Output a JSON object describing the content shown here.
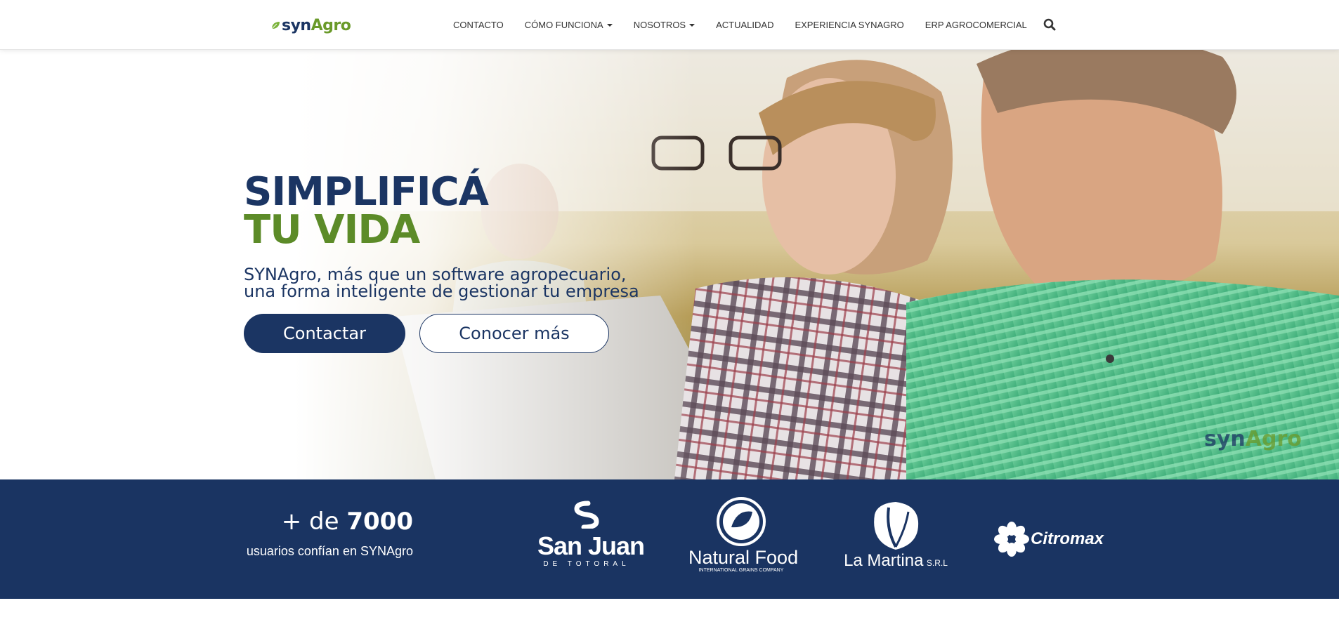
{
  "brand": {
    "logo_syn": "syn",
    "logo_agro": "Agro",
    "colors": {
      "navy": "#1b3563",
      "green": "#5c8b28"
    }
  },
  "nav": {
    "items": [
      {
        "label": "CONTACTO",
        "dropdown": false
      },
      {
        "label": "CÓMO FUNCIONA",
        "dropdown": true
      },
      {
        "label": "NOSOTROS",
        "dropdown": true
      },
      {
        "label": "ACTUALIDAD",
        "dropdown": false
      },
      {
        "label": "EXPERIENCIA SYNAGRO",
        "dropdown": false
      },
      {
        "label": "ERP AGROCOMERCIAL",
        "dropdown": false
      }
    ],
    "search_icon": "search-icon"
  },
  "hero": {
    "headline_line1": "SIMPLIFICÁ",
    "headline_line2": "TU VIDA",
    "subtitle_line1": "SYNAgro, más que un software agropecuario,",
    "subtitle_line2": "una forma inteligente de gestionar tu empresa",
    "primary_button": "Contactar",
    "secondary_button": "Conocer más",
    "watermark_syn": "syn",
    "watermark_agro": "Agro"
  },
  "clients": {
    "count_prefix": "+ de ",
    "count_value": "7000",
    "count_text": "usuarios confían en SYNAgro",
    "logos": [
      {
        "name": "San Juan",
        "subtitle": "DE TOTORAL"
      },
      {
        "name": "Natural Food",
        "subtitle": "INTERNATIONAL GRAINS COMPANY"
      },
      {
        "name": "La Martina",
        "subtitle": "S.R.L"
      },
      {
        "name": "Citromax",
        "subtitle": ""
      }
    ]
  }
}
